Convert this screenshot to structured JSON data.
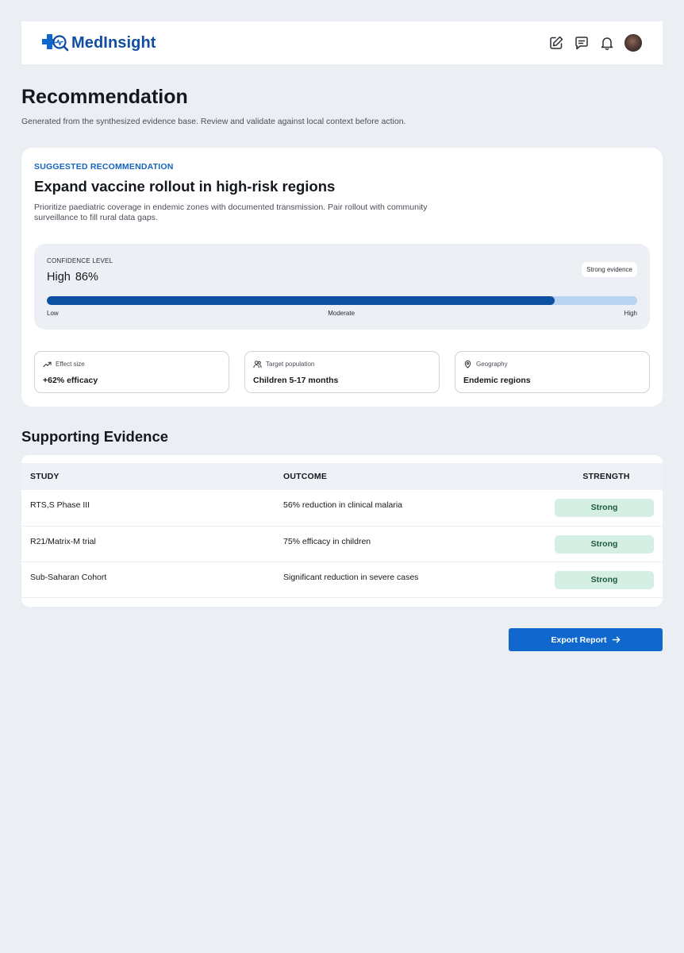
{
  "header": {
    "brand": "MedInsight",
    "actions": [
      {
        "icon": "edit-icon"
      },
      {
        "icon": "message-icon"
      },
      {
        "icon": "bell-icon"
      }
    ],
    "avatar_icon": "user-avatar"
  },
  "page": {
    "title": "Recommendation",
    "subtitle": "Generated from the synthesized evidence base. Review and validate against local context before action."
  },
  "recommendation": {
    "kicker": "SUGGESTED RECOMMENDATION",
    "title": "Expand vaccine rollout in high-risk regions",
    "description": "Prioritize paediatric coverage in endemic zones with documented transmission. Pair rollout with community surveillance to fill rural data gaps.",
    "confidence": {
      "label": "CONFIDENCE LEVEL",
      "level": "High",
      "percent_text": "86%",
      "percent_value": 86,
      "badge": "Strong evidence",
      "scale": {
        "low": "Low",
        "mid": "Moderate",
        "high": "High"
      }
    },
    "metrics": [
      {
        "icon": "trend-up-icon",
        "label": "Effect size",
        "value": "+62% efficacy"
      },
      {
        "icon": "users-icon",
        "label": "Target population",
        "value": "Children 5-17 months"
      },
      {
        "icon": "map-pin-icon",
        "label": "Geography",
        "value": "Endemic regions"
      }
    ]
  },
  "evidence": {
    "title": "Supporting Evidence",
    "columns": {
      "study": "STUDY",
      "outcome": "OUTCOME",
      "strength": "STRENGTH"
    },
    "rows": [
      {
        "study": "RTS,S Phase III",
        "outcome": "56%  reduction in clinical malaria",
        "strength": "Strong"
      },
      {
        "study": "R21/Matrix-M trial",
        "outcome": "75% efficacy in children",
        "strength": "Strong"
      },
      {
        "study": "Sub-Saharan Cohort",
        "outcome": "Significant reduction in severe cases",
        "strength": "Strong"
      }
    ]
  },
  "export": {
    "label": "Export Report",
    "icon": "arrow-right-icon"
  },
  "colors": {
    "brand": "#0f4ea3",
    "accent": "#1068cf",
    "progress_fill": "#0d4fa1",
    "progress_track": "#b7d3f1",
    "strong_pill_bg": "#d6efe5",
    "strong_pill_text": "#1d5b3f"
  }
}
